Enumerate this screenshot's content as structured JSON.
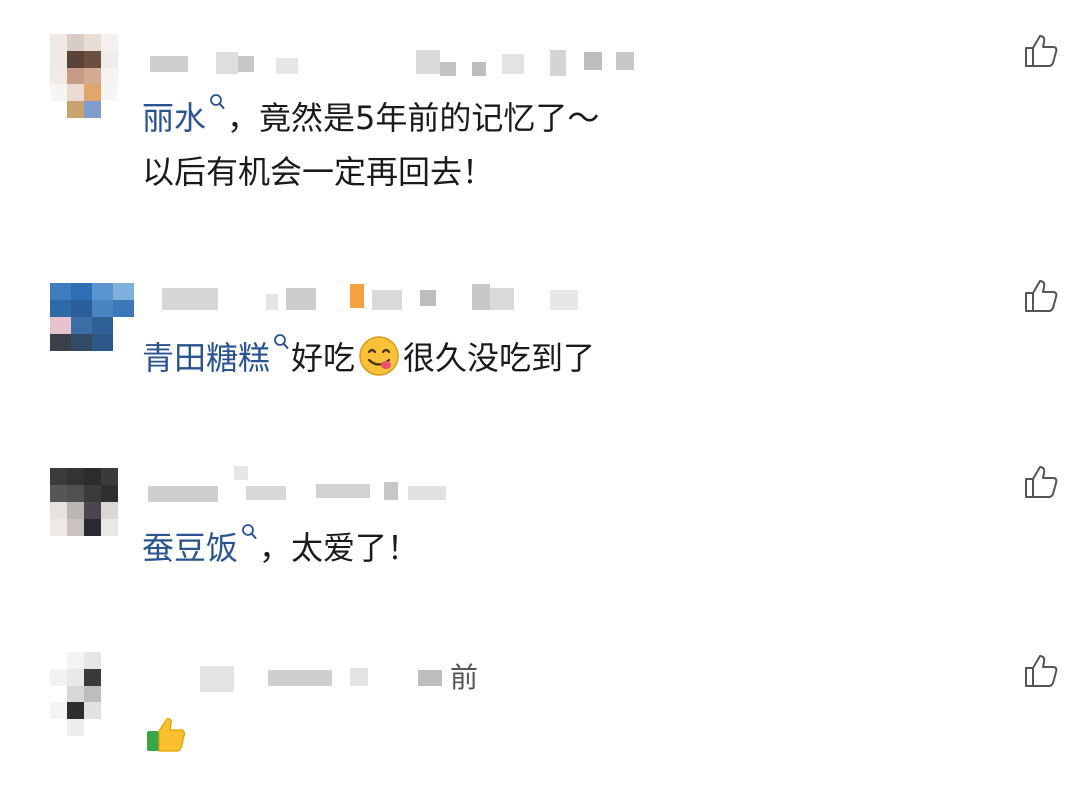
{
  "comments": [
    {
      "id": "c1",
      "link": "丽水",
      "text": "，竟然是5年前的记忆了～",
      "line2": "以后有机会一定再回去！"
    },
    {
      "id": "c2",
      "link": "青田糖糕",
      "text": "好吃",
      "text_after_emoji": "很久没吃到了",
      "emoji": "yum-face"
    },
    {
      "id": "c3",
      "link": "蚕豆饭",
      "text": "，太爱了！"
    },
    {
      "id": "c4",
      "meta_suffix": "前",
      "emoji": "thumbs-up"
    }
  ],
  "icons": {
    "like": "thumbs-up-outline-icon",
    "search": "search-icon"
  },
  "colors": {
    "link": "#2a5491",
    "text": "#1a1a1a",
    "icon": "#555555",
    "blur": "#d9d9d9"
  }
}
